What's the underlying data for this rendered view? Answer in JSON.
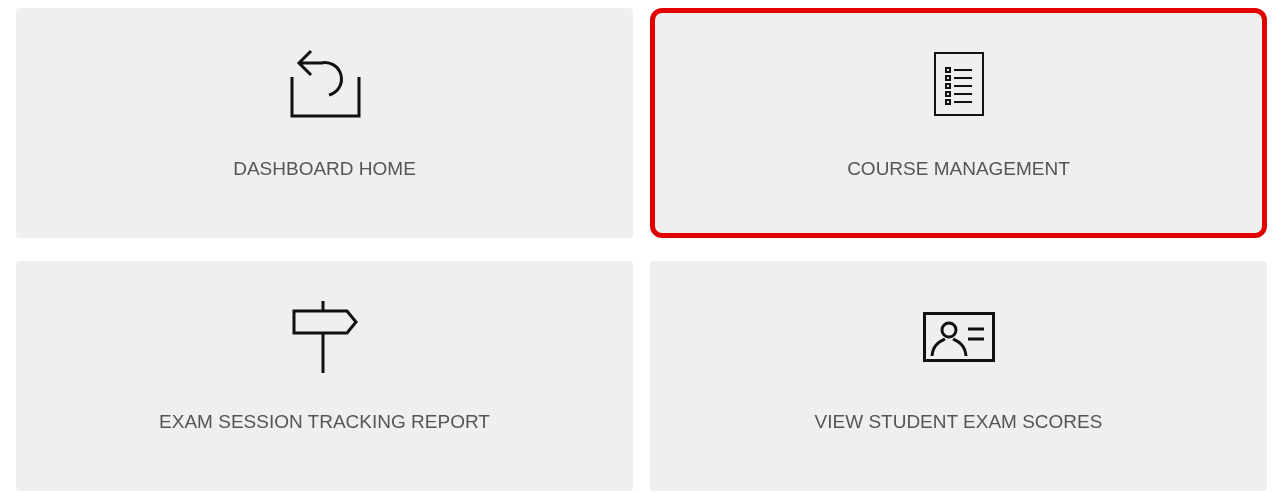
{
  "tiles": [
    {
      "label": "DASHBOARD HOME",
      "kind": "return",
      "selected": false
    },
    {
      "label": "COURSE MANAGEMENT",
      "kind": "list",
      "selected": true
    },
    {
      "label": "EXAM SESSION TRACKING REPORT",
      "kind": "signpost",
      "selected": false
    },
    {
      "label": "VIEW STUDENT EXAM SCORES",
      "kind": "idcard",
      "selected": false
    }
  ]
}
